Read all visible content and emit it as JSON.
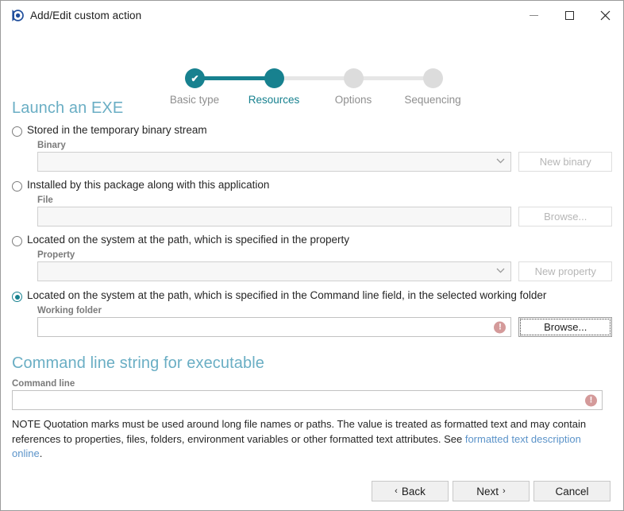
{
  "window": {
    "title": "Add/Edit custom action",
    "app_icon": "app-logo-icon",
    "minimize_label": "Minimize",
    "maximize_label": "Maximize",
    "close_label": "Close"
  },
  "stepper": {
    "steps": [
      {
        "label": "Basic type",
        "state": "done"
      },
      {
        "label": "Resources",
        "state": "active"
      },
      {
        "label": "Options",
        "state": "pending"
      },
      {
        "label": "Sequencing",
        "state": "pending"
      }
    ],
    "accent_color": "#17818f",
    "inactive_color": "#dcdcdc",
    "check_glyph": "✔"
  },
  "sections": {
    "launch": {
      "title": "Launch an EXE",
      "options": [
        {
          "radio_label": "Stored in the temporary binary stream",
          "selected": false,
          "field_label": "Binary",
          "field_value": "",
          "field_kind": "combo",
          "button_label": "New binary",
          "button_enabled": false,
          "error": false
        },
        {
          "radio_label": "Installed by this package along with this application",
          "selected": false,
          "field_label": "File",
          "field_value": "",
          "field_kind": "text",
          "button_label": "Browse...",
          "button_enabled": false,
          "error": false
        },
        {
          "radio_label": "Located on the system at the path, which is specified in the property",
          "selected": false,
          "field_label": "Property",
          "field_value": "",
          "field_kind": "combo",
          "button_label": "New property",
          "button_enabled": false,
          "error": false
        },
        {
          "radio_label": "Located on the system at the path, which is specified in the Command line field, in the selected working folder",
          "selected": true,
          "field_label": "Working folder",
          "field_value": "",
          "field_kind": "text",
          "button_label": "Browse...",
          "button_enabled": true,
          "error": true
        }
      ]
    },
    "command_line": {
      "title": "Command line string for executable",
      "field_label": "Command line",
      "field_value": "",
      "error": true,
      "note_part1": "NOTE Quotation marks must be used around long file names or paths. The value is treated as formatted text and may contain references to properties, files, folders, environment variables or other formatted text attributes. See ",
      "note_link": "formatted text description online",
      "note_part2": "."
    }
  },
  "footer": {
    "back_label": "Back",
    "back_chevron": "‹",
    "next_label": "Next",
    "next_chevron": "›",
    "cancel_label": "Cancel"
  },
  "icons": {
    "combo_arrow": "∨",
    "error": "!"
  }
}
